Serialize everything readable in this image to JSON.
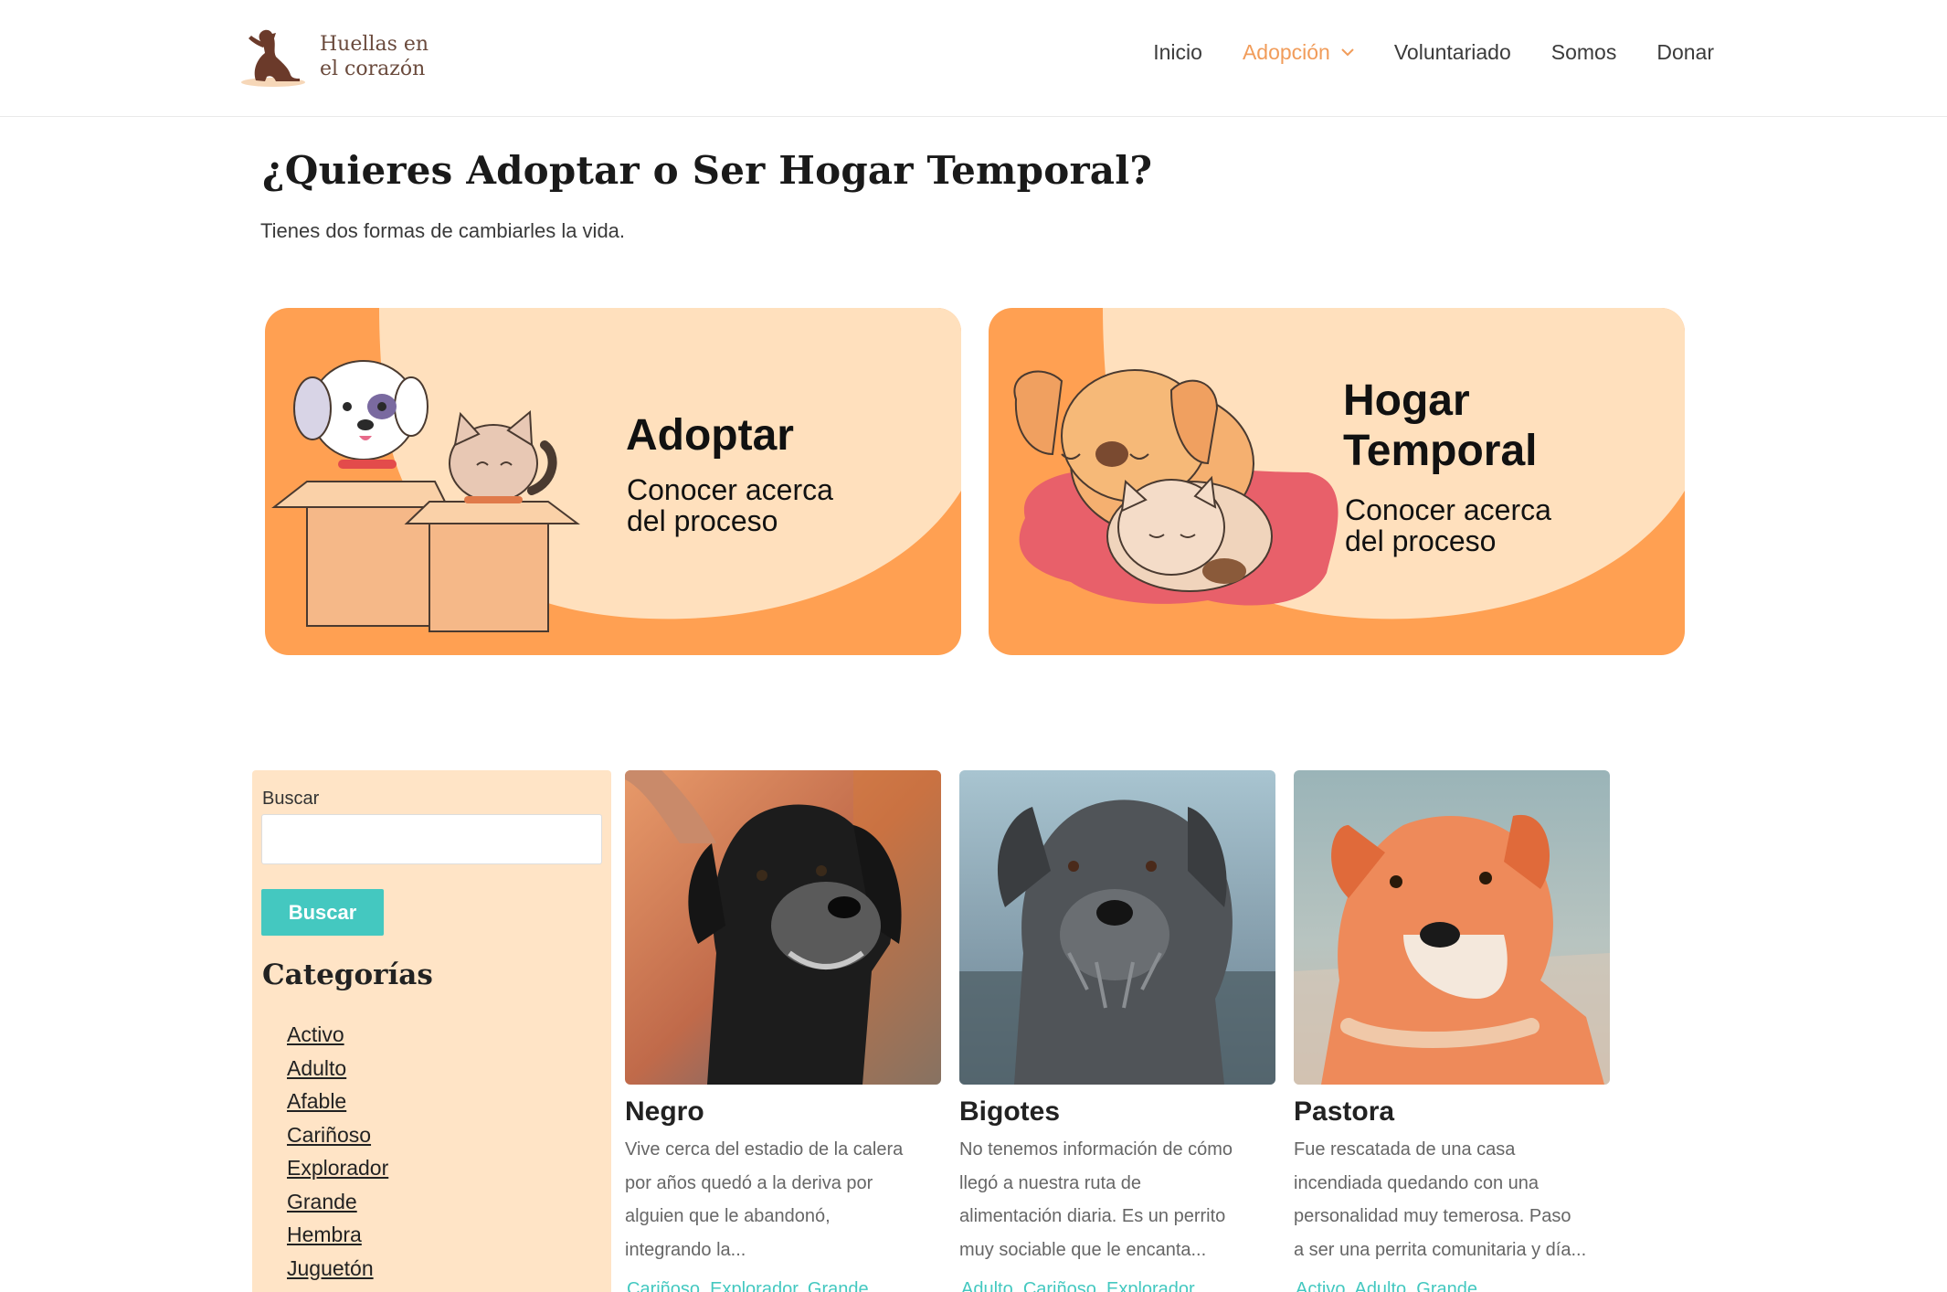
{
  "header": {
    "logo_line1": "Huellas en",
    "logo_line2": "el corazón",
    "nav": [
      {
        "label": "Inicio"
      },
      {
        "label": "Adopción"
      },
      {
        "label": "Voluntariado"
      },
      {
        "label": "Somos"
      },
      {
        "label": "Donar"
      }
    ]
  },
  "main": {
    "title": "¿Quieres Adoptar o Ser Hogar Temporal?",
    "subtitle": "Tienes dos formas de cambiarles la vida."
  },
  "banners": [
    {
      "title": "Adoptar",
      "sub_line1": "Conocer acerca",
      "sub_line2": "del proceso"
    },
    {
      "title_line1": "Hogar",
      "title_line2": "Temporal",
      "sub_line1": "Conocer acerca",
      "sub_line2": "del proceso"
    }
  ],
  "sidebar": {
    "search_label": "Buscar",
    "search_value": "",
    "search_button": "Buscar",
    "categories_title": "Categorías",
    "categories": [
      "Activo",
      "Adulto",
      "Afable",
      "Cariñoso",
      "Explorador",
      "Grande",
      "Hembra",
      "Juguetón"
    ]
  },
  "pets": [
    {
      "name": "Negro",
      "desc_lines": [
        "Vive cerca del estadio de la calera",
        "por años quedó a la deriva por",
        "alguien que le abandonó,",
        "integrando la..."
      ],
      "tags": "Cariñoso, Explorador, Grande"
    },
    {
      "name": "Bigotes",
      "desc_lines": [
        "No tenemos información de cómo",
        "llegó a nuestra ruta de",
        "alimentación diaria. Es un perrito",
        "muy sociable que le encanta..."
      ],
      "tags": "Adulto, Cariñoso, Explorador"
    },
    {
      "name": "Pastora",
      "desc_lines": [
        "Fue rescatada de una casa",
        "incendiada quedando con una",
        "personalidad muy temerosa. Paso",
        "a ser una perrita comunitaria y día..."
      ],
      "tags": "Activo, Adulto, Grande"
    }
  ],
  "colors": {
    "accent": "#f19c5a",
    "banner_orange": "#ffa052",
    "banner_cream": "#ffe0bd",
    "sidebar_bg": "#ffe4c6",
    "button_teal": "#44c8c0"
  }
}
